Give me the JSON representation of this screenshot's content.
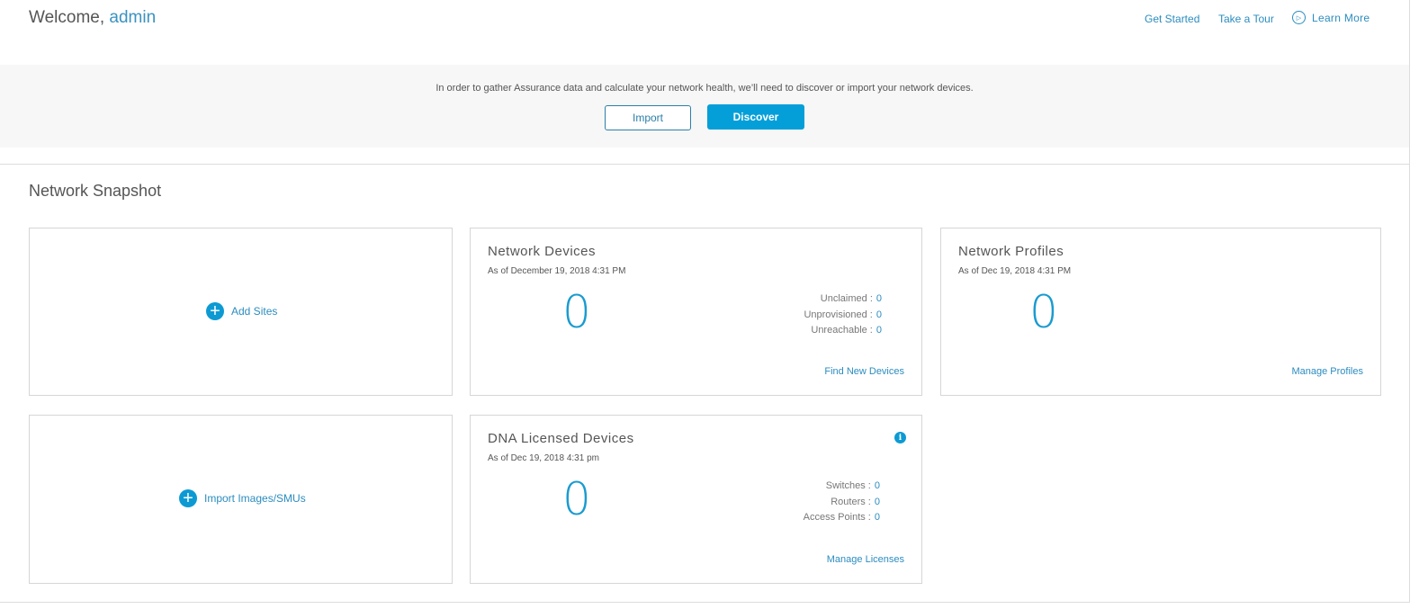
{
  "header": {
    "welcome": "Welcome,",
    "user": "admin",
    "links": [
      "Get Started",
      "Take a Tour",
      "Learn More"
    ]
  },
  "banner": {
    "message": "In order to gather Assurance data and calculate your network health, we’ll need to discover or import your network devices.",
    "import_label": "Import",
    "discover_label": "Discover"
  },
  "snapshot": {
    "title": "Network Snapshot",
    "add_sites": "Add Sites",
    "import_images": "Import Images/SMUs",
    "network_devices": {
      "title": "Network Devices",
      "as_of": "As of December 19, 2018 4:31 PM",
      "count": "0",
      "stats": [
        {
          "label": "Unclaimed :",
          "value": "0"
        },
        {
          "label": "Unprovisioned :",
          "value": "0"
        },
        {
          "label": "Unreachable :",
          "value": "0"
        }
      ],
      "link": "Find New Devices"
    },
    "network_profiles": {
      "title": "Network Profiles",
      "as_of": "As of Dec 19, 2018 4:31 PM",
      "count": "0",
      "link": "Manage Profiles"
    },
    "dna_licensed": {
      "title": "DNA Licensed Devices",
      "as_of": "As of Dec 19, 2018 4:31 pm",
      "count": "0",
      "stats": [
        {
          "label": "Switches :",
          "value": "0"
        },
        {
          "label": "Routers :",
          "value": "0"
        },
        {
          "label": "Access Points :",
          "value": "0"
        }
      ],
      "link": "Manage Licenses"
    }
  },
  "colors": {
    "accent": "#0d9ad3",
    "link": "#2b8cbf"
  }
}
